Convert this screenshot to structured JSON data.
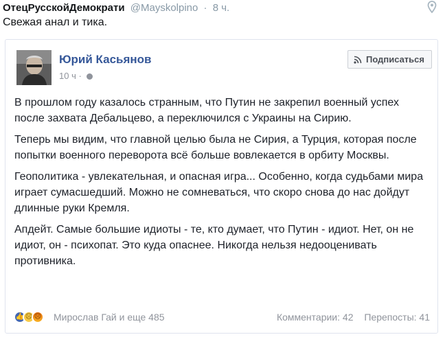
{
  "tweet": {
    "author_name": "ОтецРусскойДемократи",
    "handle": "@Mayskolpino",
    "separator": "·",
    "time": "8 ч.",
    "text": "Свежая анал и тика."
  },
  "fb_post": {
    "author": "Юрий Касьянов",
    "time": "10 ч",
    "subscribe_label": "Подписаться",
    "paragraphs": [
      "В прошлом году казалось странным, что Путин не закрепил военный успех после захвата Дебальцево, а переключился с Украины на Сирию.",
      "Теперь мы видим, что главной целью была не Сирия, а Турция, которая после попытки военного переворота всё больше вовлекается в орбиту Москвы.",
      "Геополитика - увлекательная, и опасная игра... Особенно, когда судьбами мира играет сумасшедший. Можно не сомневаться, что скоро снова до нас дойдут длинные руки Кремля.",
      "Апдейт. Самые большие идиоты - те, кто думает, что Путин - идиот. Нет, он не идиот, он - психопат. Это куда опаснее. Никогда нельзя недооценивать противника."
    ],
    "reactions_text": "Мирослав Гай и еще 485",
    "comments": "Комментарии: 42",
    "shares": "Перепосты: 41"
  },
  "icons": {
    "pin": "map-pin-icon",
    "rss": "rss-icon",
    "globe": "globe-icon",
    "reactions": [
      "like-icon",
      "sad-icon",
      "angry-icon"
    ]
  },
  "colors": {
    "fb_link": "#365899",
    "muted": "#90949c",
    "like_blue": "#4267b2"
  }
}
